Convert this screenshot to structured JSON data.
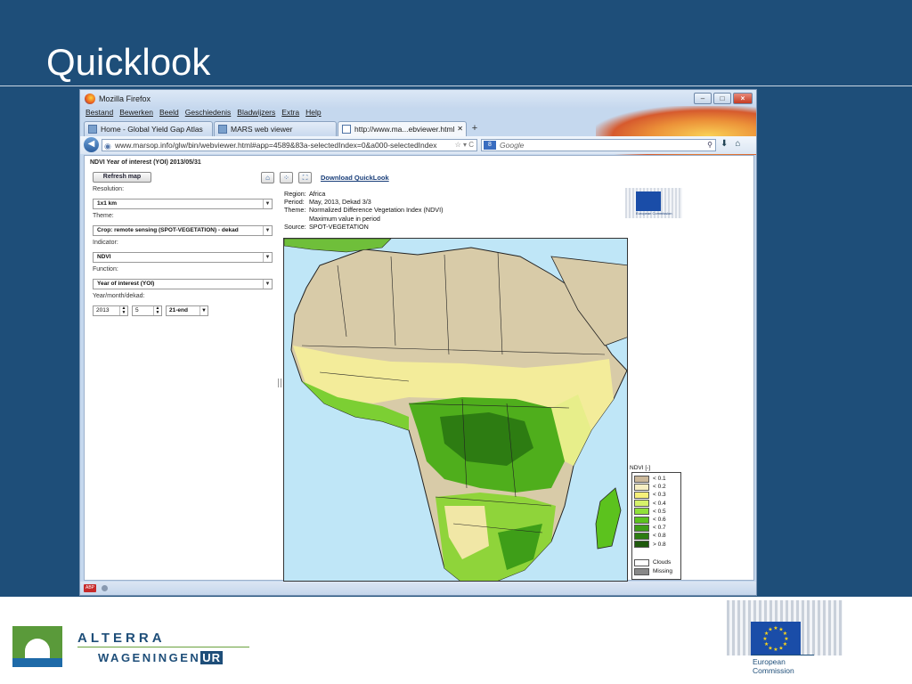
{
  "slide": {
    "title": "Quicklook"
  },
  "browser": {
    "window_title": "Mozilla Firefox",
    "menu": [
      "Bestand",
      "Bewerken",
      "Beeld",
      "Geschiedenis",
      "Bladwijzers",
      "Extra",
      "Help"
    ],
    "tabs": [
      {
        "label": "Home - Global Yield Gap Atlas",
        "active": false
      },
      {
        "label": "MARS web viewer",
        "active": false
      },
      {
        "label": "http://www.ma...ebviewer.html",
        "active": true
      }
    ],
    "new_tab": "+",
    "url": "www.marsop.info/glw/bin/webviewer.html#app=4589&83a-selectedIndex=0&a000-selectedIndex",
    "search_placeholder": "Google",
    "search_engine": "8"
  },
  "page": {
    "header": "NDVI Year of interest (YOI) 2013/05/31",
    "refresh_label": "Refresh map",
    "download_label": "Download QuickLook",
    "fields": {
      "resolution_label": "Resolution:",
      "resolution_value": "1x1 km",
      "theme_label": "Theme:",
      "theme_value": "Crop: remote sensing (SPOT-VEGETATION) - dekad",
      "indicator_label": "Indicator:",
      "indicator_value": "NDVI",
      "function_label": "Function:",
      "function_value": "Year of interest (YOI)",
      "date_label": "Year/month/dekad:",
      "year": "2013",
      "month": "5",
      "dekad": "21-end"
    },
    "meta": {
      "region_k": "Region:",
      "region_v": "Africa",
      "period_k": "Period:",
      "period_v": "May, 2013, Dekad 3/3",
      "theme_k": "Theme:",
      "theme_v": "Normalized Difference Vegetation Index (NDVI)",
      "theme_v2": "Maximum value in period",
      "source_k": "Source:",
      "source_v": "SPOT-VEGETATION"
    },
    "eu_small_text": "European Commission",
    "legend": {
      "title": "NDVI [-]",
      "items": [
        {
          "label": "< 0.1",
          "color": "#cbb89a"
        },
        {
          "label": "< 0.2",
          "color": "#f6efc2"
        },
        {
          "label": "< 0.3",
          "color": "#f7f07a"
        },
        {
          "label": "< 0.4",
          "color": "#d6f26a"
        },
        {
          "label": "< 0.5",
          "color": "#8fe03a"
        },
        {
          "label": "< 0.6",
          "color": "#5cc21e"
        },
        {
          "label": "< 0.7",
          "color": "#3e9e18"
        },
        {
          "label": "< 0.8",
          "color": "#2c7c12"
        },
        {
          "label": "> 0.8",
          "color": "#1e5a0c"
        },
        {
          "label": "Clouds",
          "color": "#ffffff"
        },
        {
          "label": "Missing",
          "color": "#888888"
        }
      ]
    },
    "status_badge": "ABP"
  },
  "footer": {
    "alterra": "ALTERRA",
    "wageningen": "WAGENINGEN",
    "ur": "UR",
    "ec_line1": "European",
    "ec_line2": "Commission"
  },
  "colors": {
    "slide_bg": "#1e4e79",
    "eu_blue": "#1a4da8",
    "ocean": "#bfe6f7"
  }
}
